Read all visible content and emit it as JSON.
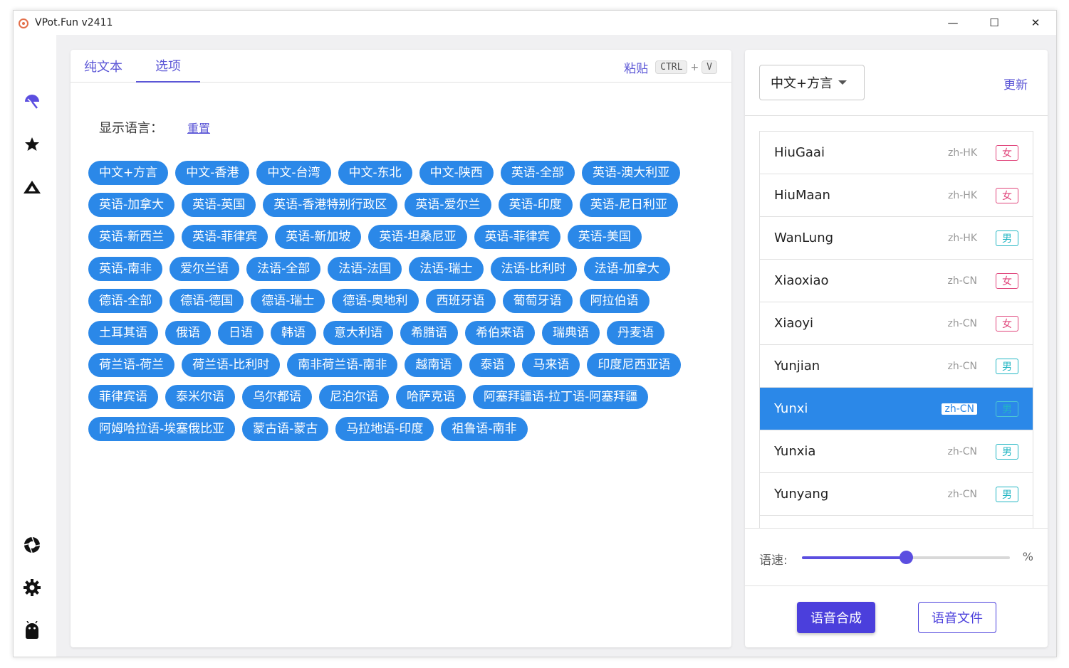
{
  "window": {
    "title": "VPot.Fun v2411",
    "controls": [
      "—",
      "☐",
      "✕"
    ]
  },
  "sidebar": {
    "icons": [
      "umbrella-icon",
      "star-icon",
      "mountain-logo-icon",
      "aperture-icon",
      "gear-icon",
      "android-icon"
    ]
  },
  "tabs": {
    "plain_text": "纯文本",
    "options": "选项"
  },
  "paste": {
    "label": "粘贴",
    "key1": "CTRL",
    "plus": "+",
    "key2": "V"
  },
  "language": {
    "label": "显示语言：",
    "reset": "重置"
  },
  "chips": [
    "中文+方言",
    "中文-香港",
    "中文-台湾",
    "中文-东北",
    "中文-陕西",
    "英语-全部",
    "英语-澳大利亚",
    "英语-加拿大",
    "英语-英国",
    "英语-香港特别行政区",
    "英语-爱尔兰",
    "英语-印度",
    "英语-尼日利亚",
    "英语-新西兰",
    "英语-菲律宾",
    "英语-新加坡",
    "英语-坦桑尼亚",
    "英语-菲律宾",
    "英语-美国",
    "英语-南非",
    "爱尔兰语",
    "法语-全部",
    "法语-法国",
    "法语-瑞士",
    "法语-比利时",
    "法语-加拿大",
    "德语-全部",
    "德语-德国",
    "德语-瑞士",
    "德语-奥地利",
    "西班牙语",
    "葡萄牙语",
    "阿拉伯语",
    "土耳其语",
    "俄语",
    "日语",
    "韩语",
    "意大利语",
    "希腊语",
    "希伯来语",
    "瑞典语",
    "丹麦语",
    "荷兰语-荷兰",
    "荷兰语-比利时",
    "南非荷兰语-南非",
    "越南语",
    "泰语",
    "马来语",
    "印度尼西亚语",
    "菲律宾语",
    "泰米尔语",
    "乌尔都语",
    "尼泊尔语",
    "哈萨克语",
    "阿塞拜疆语-拉丁语-阿塞拜疆",
    "阿姆哈拉语-埃塞俄比亚",
    "蒙古语-蒙古",
    "马拉地语-印度",
    "祖鲁语-南非"
  ],
  "voice_panel": {
    "filter_value": "中文+方言",
    "refresh": "更新",
    "voices": [
      {
        "name": "HiuGaai",
        "locale": "zh-HK",
        "gender": "女"
      },
      {
        "name": "HiuMaan",
        "locale": "zh-HK",
        "gender": "女"
      },
      {
        "name": "WanLung",
        "locale": "zh-HK",
        "gender": "男"
      },
      {
        "name": "Xiaoxiao",
        "locale": "zh-CN",
        "gender": "女"
      },
      {
        "name": "Xiaoyi",
        "locale": "zh-CN",
        "gender": "女"
      },
      {
        "name": "Yunjian",
        "locale": "zh-CN",
        "gender": "男"
      },
      {
        "name": "Yunxi",
        "locale": "zh-CN",
        "gender": "男"
      },
      {
        "name": "Yunxia",
        "locale": "zh-CN",
        "gender": "男"
      },
      {
        "name": "Yunyang",
        "locale": "zh-CN",
        "gender": "男"
      }
    ],
    "selected_index": 6,
    "speed_label": "语速:",
    "speed_value": 0.5,
    "speed_unit": "%",
    "synthesize": "语音合成",
    "audio_file": "语音文件"
  },
  "colors": {
    "accent": "#5b56d6",
    "chip": "#2b88e8",
    "primary_button": "#4b3fdc",
    "female": "#e0457b",
    "male": "#22b6c3"
  }
}
